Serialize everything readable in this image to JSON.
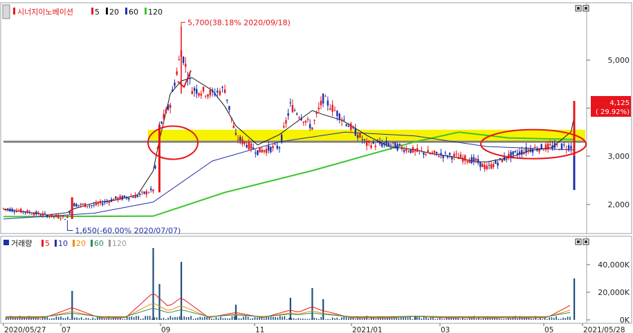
{
  "price_panel": {
    "legend": {
      "name": "시너지이노베이션",
      "ma_labels": [
        {
          "label": "5",
          "color": "#e8141b"
        },
        {
          "label": "20",
          "color": "#111111"
        },
        {
          "label": "60",
          "color": "#1f2fa8"
        },
        {
          "label": "120",
          "color": "#39c52c"
        }
      ]
    },
    "y_ticks": [
      "5,000",
      "4,000",
      "3,000",
      "2,000"
    ],
    "high_label": "5,700(38.18% 2020/09/18)",
    "low_label": "1,650(-60.00% 2020/07/07)",
    "last_price": "4,125",
    "last_change": "( 29.92%)"
  },
  "volume_panel": {
    "legend": {
      "name": "거래량",
      "ma_labels": [
        {
          "label": "5",
          "color": "#e8141b"
        },
        {
          "label": "10",
          "color": "#1f2fa8"
        },
        {
          "label": "20",
          "color": "#f08a00"
        },
        {
          "label": "60",
          "color": "#2e8b57"
        },
        {
          "label": "120",
          "color": "#9a9a9a"
        }
      ]
    },
    "y_ticks": [
      "40,000K",
      "20,000K",
      "0K"
    ]
  },
  "x_axis": {
    "labels": [
      "2020/05/27",
      "07",
      "09",
      "11",
      "2021/01",
      "03",
      "05",
      "2021/05/28"
    ]
  },
  "colors": {
    "up": "#e8141b",
    "down": "#1f2fa8",
    "ma5": "#e8141b",
    "ma20": "#111111",
    "ma60": "#1f2fa8",
    "ma120": "#39c52c",
    "highlight": "#f7f200",
    "annotation": "#e8141b",
    "support_line": "#808080",
    "volume_bar": "#1f4e79"
  },
  "chart_data": {
    "type": "candlestick",
    "title": "시너지이노베이션",
    "x_range": [
      "2020/05/27",
      "2021/05/28"
    ],
    "price_ylim": [
      1450,
      5900
    ],
    "volume_ylim": [
      0,
      55000
    ],
    "volume_unit": "K",
    "price_series": [
      {
        "date": "2020/05/27",
        "close": 1920
      },
      {
        "date": "2020/06/10",
        "close": 1850
      },
      {
        "date": "2020/06/24",
        "close": 1780
      },
      {
        "date": "2020/07/07",
        "close": 1720
      },
      {
        "date": "2020/07/10",
        "close": 2000
      },
      {
        "date": "2020/07/24",
        "close": 1980
      },
      {
        "date": "2020/08/07",
        "close": 2120
      },
      {
        "date": "2020/08/21",
        "close": 2180
      },
      {
        "date": "2020/08/31",
        "close": 2300
      },
      {
        "date": "2020/09/04",
        "close": 3600
      },
      {
        "date": "2020/09/11",
        "close": 4100
      },
      {
        "date": "2020/09/18",
        "close": 5200
      },
      {
        "date": "2020/09/25",
        "close": 4400
      },
      {
        "date": "2020/10/08",
        "close": 4300
      },
      {
        "date": "2020/10/16",
        "close": 4400
      },
      {
        "date": "2020/10/23",
        "close": 3400
      },
      {
        "date": "2020/11/06",
        "close": 3100
      },
      {
        "date": "2020/11/20",
        "close": 3200
      },
      {
        "date": "2020/11/27",
        "close": 4050
      },
      {
        "date": "2020/12/11",
        "close": 3600
      },
      {
        "date": "2020/12/18",
        "close": 4200
      },
      {
        "date": "2020/12/30",
        "close": 3800
      },
      {
        "date": "2021/01/15",
        "close": 3250
      },
      {
        "date": "2021/01/29",
        "close": 3250
      },
      {
        "date": "2021/02/15",
        "close": 3100
      },
      {
        "date": "2021/02/26",
        "close": 3050
      },
      {
        "date": "2021/03/12",
        "close": 3000
      },
      {
        "date": "2021/03/26",
        "close": 2900
      },
      {
        "date": "2021/04/02",
        "close": 2750
      },
      {
        "date": "2021/04/16",
        "close": 3000
      },
      {
        "date": "2021/04/30",
        "close": 3150
      },
      {
        "date": "2021/05/14",
        "close": 3200
      },
      {
        "date": "2021/05/26",
        "close": 3200
      },
      {
        "date": "2021/05/28",
        "close": 4125
      }
    ],
    "ma_series": [
      {
        "name": "120",
        "values": [
          {
            "date": "2020/05/27",
            "v": 1750
          },
          {
            "date": "2020/08/31",
            "v": 1760
          },
          {
            "date": "2020/10/16",
            "v": 2250
          },
          {
            "date": "2020/12/11",
            "v": 2700
          },
          {
            "date": "2021/02/15",
            "v": 3300
          },
          {
            "date": "2021/03/15",
            "v": 3500
          },
          {
            "date": "2021/04/16",
            "v": 3380
          },
          {
            "date": "2021/05/28",
            "v": 3350
          }
        ]
      },
      {
        "name": "60",
        "values": [
          {
            "date": "2020/05/27",
            "v": 1700
          },
          {
            "date": "2020/07/24",
            "v": 1820
          },
          {
            "date": "2020/08/31",
            "v": 2050
          },
          {
            "date": "2020/10/08",
            "v": 2900
          },
          {
            "date": "2020/11/20",
            "v": 3300
          },
          {
            "date": "2021/01/01",
            "v": 3500
          },
          {
            "date": "2021/02/15",
            "v": 3420
          },
          {
            "date": "2021/04/02",
            "v": 3200
          },
          {
            "date": "2021/05/28",
            "v": 3130
          }
        ]
      }
    ],
    "volume_series": [
      {
        "date": "2020/07/10",
        "volume": 21000
      },
      {
        "date": "2020/08/31",
        "volume": 52000
      },
      {
        "date": "2020/09/04",
        "volume": 26000
      },
      {
        "date": "2020/09/18",
        "volume": 42000
      },
      {
        "date": "2020/10/23",
        "volume": 11000
      },
      {
        "date": "2020/11/27",
        "volume": 16000
      },
      {
        "date": "2020/12/11",
        "volume": 23000
      },
      {
        "date": "2020/12/18",
        "volume": 15000
      },
      {
        "date": "2021/02/15",
        "volume": 3000
      },
      {
        "date": "2021/05/28",
        "volume": 30000
      }
    ],
    "annotations": [
      {
        "type": "max",
        "value": 5700,
        "date": "2020/09/18",
        "text": "5,700(38.18% 2020/09/18)"
      },
      {
        "type": "min",
        "value": 1650,
        "date": "2020/07/07",
        "text": "1,650(-60.00% 2020/07/07)"
      }
    ],
    "support_level": 3300,
    "highlight_band": [
      3300,
      3550
    ]
  }
}
